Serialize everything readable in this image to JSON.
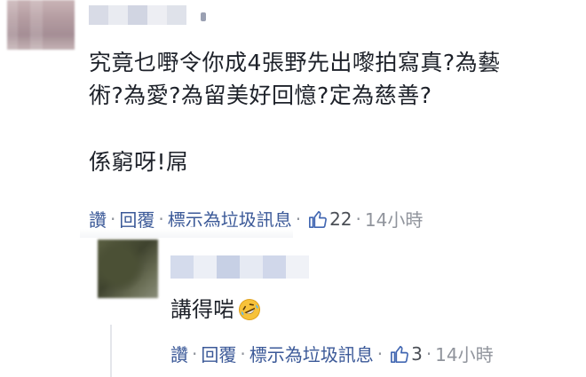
{
  "comment": {
    "line1": "究竟乜嘢令你成4張野先出嚟拍寫真?為藝",
    "line2": "術?為愛?為留美好回憶?定為慈善?",
    "line3": "係窮呀!屌",
    "actions": {
      "like": "讚",
      "reply": "回覆",
      "spam": "標示為垃圾訊息",
      "like_count": "22",
      "time": "14小時"
    }
  },
  "reply": {
    "text": "講得啱",
    "emoji": "laughing-crying-emoji",
    "actions": {
      "like": "讚",
      "reply": "回覆",
      "spam": "標示為垃圾訊息",
      "like_count": "3",
      "time": "14小時"
    }
  },
  "colors": {
    "link": "#3b5998",
    "meta": "#90949c",
    "like_icon": "#4267b2",
    "emoji": "#f7c23a"
  }
}
